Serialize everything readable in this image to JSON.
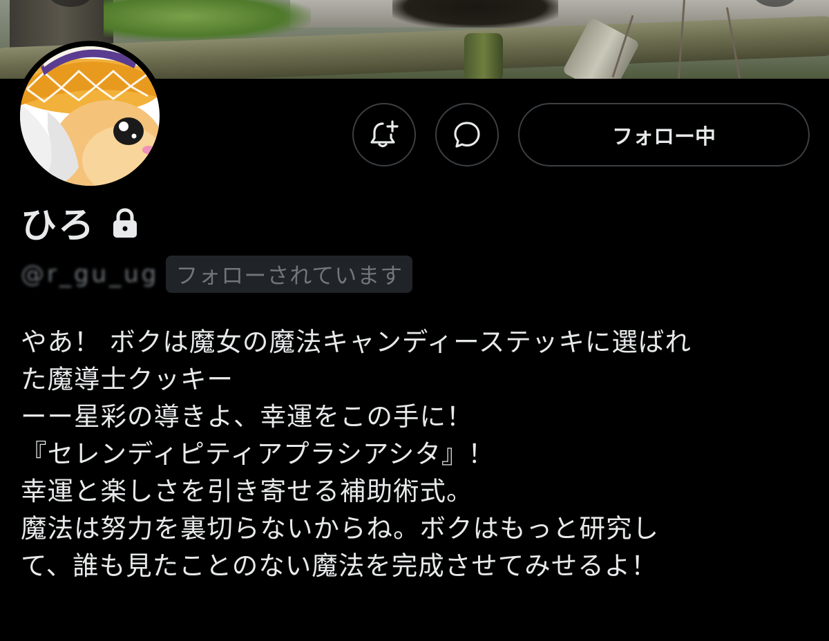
{
  "profile": {
    "display_name": "ひろ",
    "handle": "@r_gu_ug",
    "follows_you_label": "フォローされています",
    "bio_lines": [
      "やあ！ ボクは魔女の魔法キャンディーステッキに選ばれ",
      "た魔導士クッキー",
      "ーー星彩の導きよ、幸運をこの手に！",
      "『セレンディピティアプラシアシタ』！",
      "幸運と楽しさを引き寄せる補助術式。",
      "魔法は努力を裏切らないからね。ボクはもっと研究し",
      "て、誰も見たことのない魔法を完成させてみせるよ！"
    ]
  },
  "actions": {
    "notify_icon": "bell-plus-icon",
    "message_icon": "message-bubble-icon",
    "follow_label": "フォロー中"
  },
  "colors": {
    "background": "#000000",
    "text_primary": "#e7e9ea",
    "text_secondary": "#71767b",
    "button_border": "#3c4043",
    "badge_background": "#202327"
  }
}
